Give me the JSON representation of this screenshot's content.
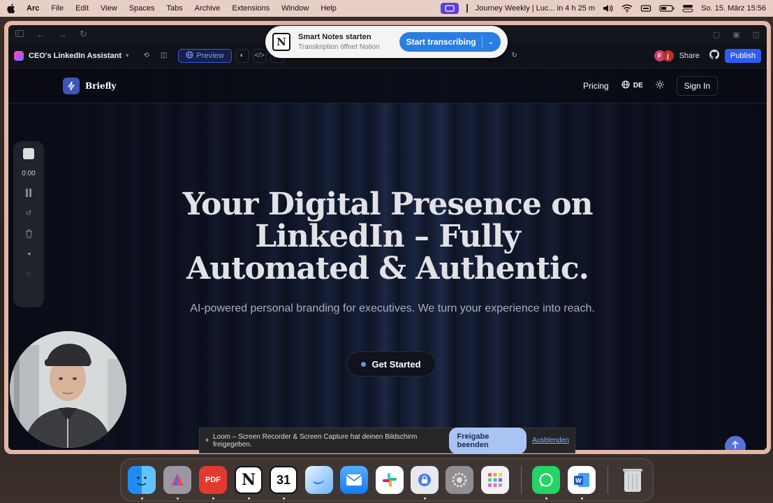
{
  "menubar": {
    "app": "Arc",
    "items": [
      "File",
      "Edit",
      "View",
      "Spaces",
      "Tabs",
      "Archive",
      "Extensions",
      "Window",
      "Help"
    ],
    "event": "Journey Weekly | Luc... in 4 h 25 m",
    "datetime": "So. 15. März  15:56"
  },
  "notion_popup": {
    "title": "Smart Notes starten",
    "subtitle": "Transkription öffnet Notion",
    "button": "Start transcribing"
  },
  "toolbar": {
    "project": "CEO's LinkedIn Assistant",
    "preview": "Preview",
    "avatars": [
      "F",
      "j"
    ],
    "share": "Share",
    "publish": "Publish"
  },
  "site": {
    "brand": "Briefly",
    "nav": {
      "pricing": "Pricing",
      "lang": "DE",
      "signin": "Sign In"
    },
    "hero": {
      "line1": "Your Digital Presence on",
      "line2": "LinkedIn – Fully",
      "line3": "Automated & Authentic.",
      "subtitle": "AI-powered personal branding for executives. We turn your experience into reach.",
      "cta": "Get Started"
    }
  },
  "loom": {
    "timer": "0:00",
    "share_text": "Loom – Screen Recorder & Screen Capture hat deinen Bildschirm freigegeben.",
    "stop_sharing": "Freigabe beenden",
    "hide": "Ausblenden"
  },
  "dock": {
    "calendar_day": "31",
    "pdf_label": "PDF"
  },
  "colors": {
    "accent": "#2f5cf0",
    "menubar": "#e8cfc6",
    "window_frame": "#e4b6a8"
  }
}
